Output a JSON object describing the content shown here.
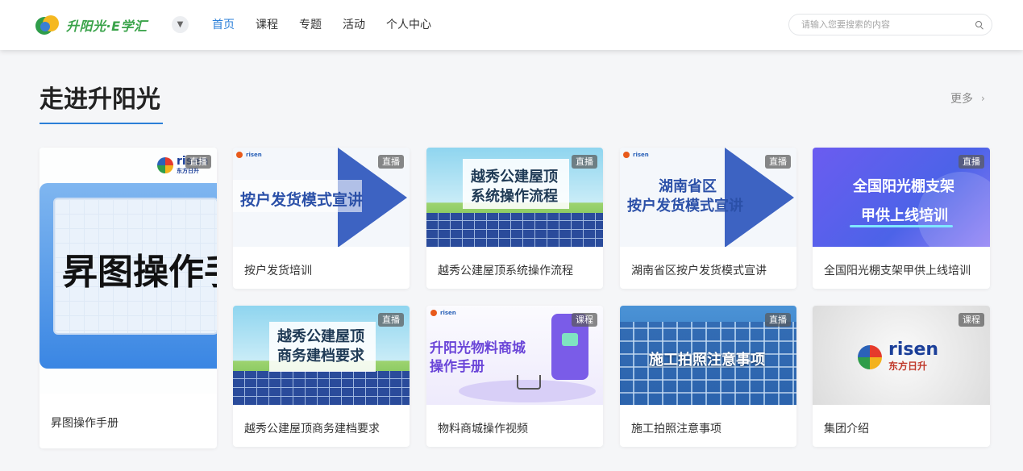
{
  "header": {
    "logo_text": "升阳光·E学汇",
    "nav": [
      {
        "label": "首页",
        "active": true
      },
      {
        "label": "课程",
        "active": false
      },
      {
        "label": "专题",
        "active": false
      },
      {
        "label": "活动",
        "active": false
      },
      {
        "label": "个人中心",
        "active": false
      }
    ],
    "search_placeholder": "请输入您要搜索的内容"
  },
  "section": {
    "title": "走进升阳光",
    "more_label": "更多",
    "accent_color": "#2b7fd8"
  },
  "cards": [
    {
      "title": "昇图操作手册",
      "badge": "直播",
      "thumb_text": "昇图操作手"
    },
    {
      "title": "按户发货培训",
      "badge": "直播",
      "thumb_text": "按户发货模式宣讲"
    },
    {
      "title": "越秀公建屋顶系统操作流程",
      "badge": "直播",
      "thumb_line1": "越秀公建屋顶",
      "thumb_line2": "系统操作流程"
    },
    {
      "title": "湖南省区按户发货模式宣讲",
      "badge": "直播",
      "thumb_line1": "湖南省区",
      "thumb_line2": "按户发货模式宣讲"
    },
    {
      "title": "全国阳光棚支架甲供上线培训",
      "badge": "直播",
      "thumb_line1": "全国阳光棚支架",
      "thumb_line2": "甲供上线培训"
    },
    {
      "title": "越秀公建屋顶商务建档要求",
      "badge": "直播",
      "thumb_line1": "越秀公建屋顶",
      "thumb_line2": "商务建档要求"
    },
    {
      "title": "物料商城操作视频",
      "badge": "课程",
      "thumb_line1": "升阳光物料商城",
      "thumb_line2": "操作手册"
    },
    {
      "title": "施工拍照注意事项",
      "badge": "直播",
      "thumb_text": "施工拍照注意事项"
    },
    {
      "title": "集团介绍",
      "badge": "课程",
      "brand_word": "risen",
      "brand_sub": "东方日升"
    }
  ],
  "brand": {
    "word": "risen",
    "sub": "东方日升"
  },
  "icons": [
    "search-icon",
    "chevron-down-icon",
    "chevron-right-icon",
    "cart-icon",
    "lock-icon"
  ]
}
